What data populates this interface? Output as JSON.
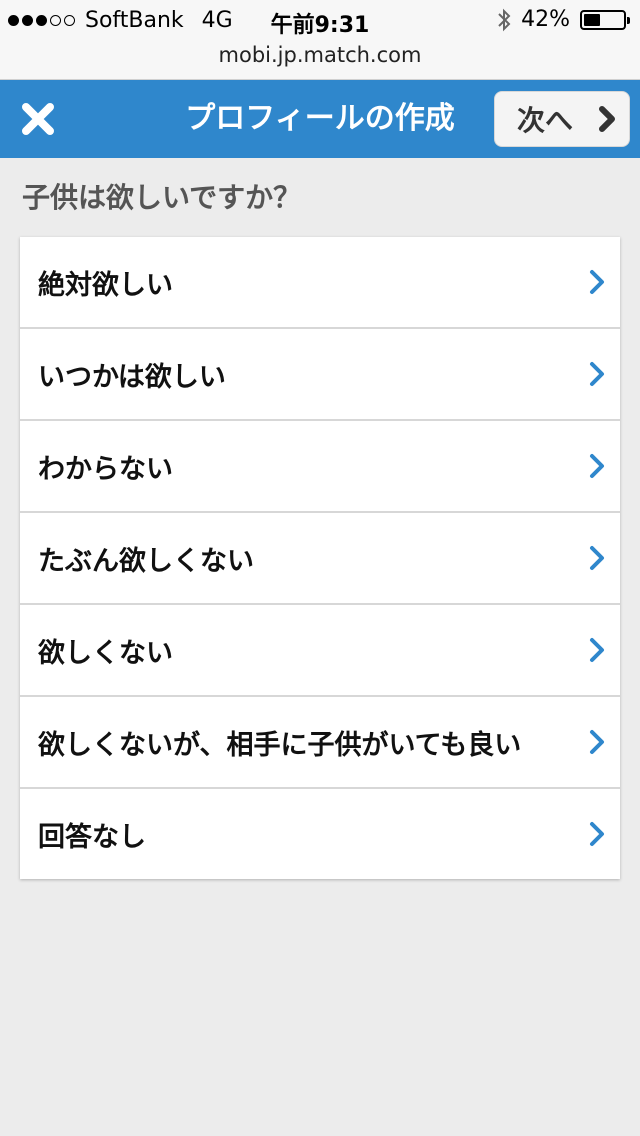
{
  "status": {
    "carrier": "SoftBank",
    "network": "4G",
    "time": "午前9:31",
    "battery_percent": "42%",
    "battery_level": 0.42
  },
  "browser": {
    "url": "mobi.jp.match.com"
  },
  "nav": {
    "title": "プロフィールの作成",
    "next_label": "次へ"
  },
  "question": "子供は欲しいですか？",
  "options": [
    "絶対欲しい",
    "いつかは欲しい",
    "わからない",
    "たぶん欲しくない",
    "欲しくない",
    "欲しくないが、相手に子供がいても良い",
    "回答なし"
  ],
  "colors": {
    "accent": "#2f87cc",
    "chevron": "#2f87cc"
  }
}
